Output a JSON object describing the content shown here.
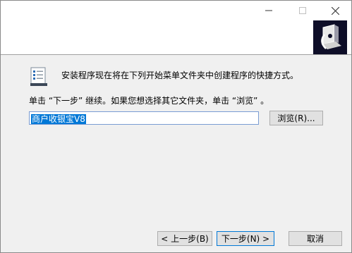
{
  "window": {
    "controls": {
      "minimize": "minimize-icon",
      "maximize": "maximize-icon",
      "close": "close-icon"
    }
  },
  "main": {
    "instruction": "安装程序现在将在下列开始菜单文件夹中创建程序的快捷方式。",
    "hint": "单击 “下一步” 继续。如果您想选择其它文件夹，单击 “浏览” 。",
    "folder_value": "商户收银宝V8",
    "browse_label": "浏览(R)..."
  },
  "footer": {
    "back_label": "< 上一步(B)",
    "next_label": "下一步(N) >",
    "cancel_label": "取消"
  },
  "colors": {
    "selection": "#0078d7",
    "panel": "#f0f0f0",
    "logo_bg": "#0e0e28"
  }
}
